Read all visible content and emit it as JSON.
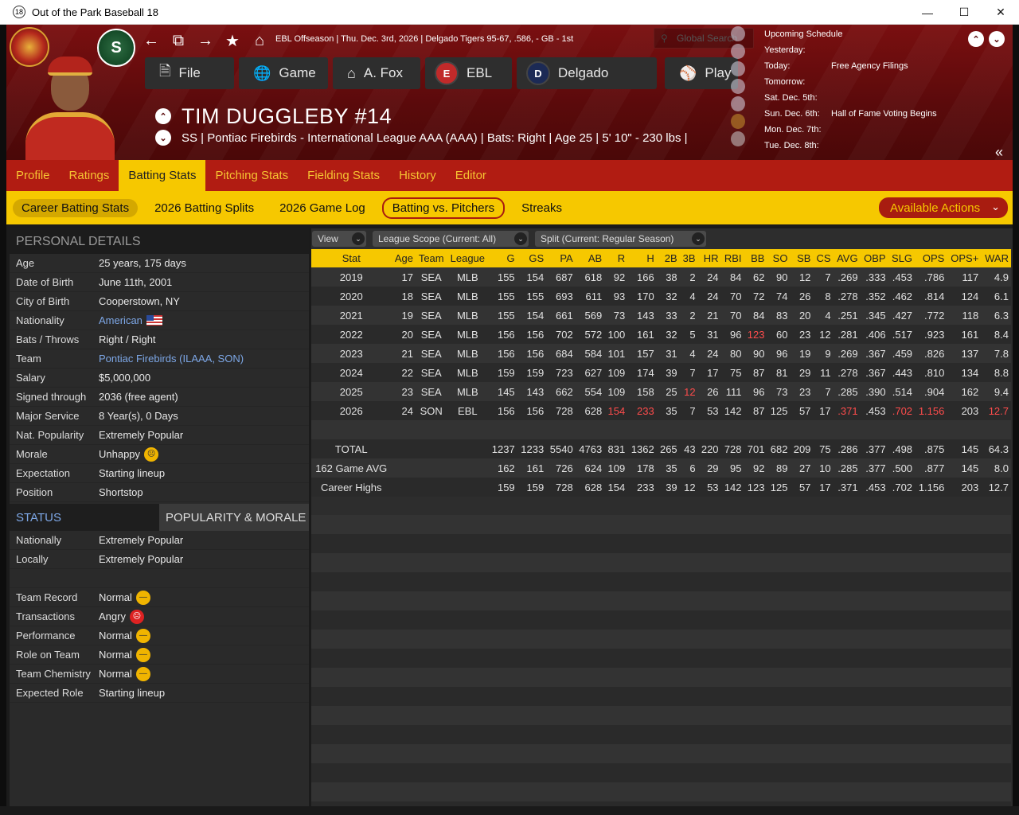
{
  "window": {
    "app_icon": "18",
    "title": "Out of the Park Baseball 18"
  },
  "breadcrumb": "EBL Offseason  |  Thu. Dec. 3rd, 2026  |  Delgado Tigers   95-67, .586, - GB - 1st",
  "search": {
    "placeholder": "Global Search"
  },
  "main_buttons": {
    "file": "File",
    "game": "Game",
    "manager": "A. Fox",
    "league": "EBL",
    "team": "Delgado",
    "play": "Play"
  },
  "player": {
    "name": "TIM DUGGLEBY  #14",
    "subtitle": "SS | Pontiac Firebirds - International League AAA (AAA)  |  Bats: Right  |  Age 25  |  5' 10\" - 230 lbs  |"
  },
  "schedule": {
    "title": "Upcoming Schedule",
    "rows": [
      {
        "day": "Yesterday:",
        "event": ""
      },
      {
        "day": "Today:",
        "event": "Free Agency Filings"
      },
      {
        "day": "Tomorrow:",
        "event": ""
      },
      {
        "day": "Sat. Dec. 5th:",
        "event": ""
      },
      {
        "day": "Sun. Dec. 6th:",
        "event": "Hall of Fame Voting Begins"
      },
      {
        "day": "Mon. Dec. 7th:",
        "event": ""
      },
      {
        "day": "Tue. Dec. 8th:",
        "event": ""
      }
    ]
  },
  "tabs": [
    "Profile",
    "Ratings",
    "Batting Stats",
    "Pitching Stats",
    "Fielding Stats",
    "History",
    "Editor"
  ],
  "subtabs": [
    "Career Batting Stats",
    "2026 Batting Splits",
    "2026 Game Log",
    "Batting vs. Pitchers",
    "Streaks"
  ],
  "available_actions": "Available Actions",
  "personal": {
    "heading": "PERSONAL DETAILS",
    "rows": [
      {
        "label": "Age",
        "value": "25 years, 175 days"
      },
      {
        "label": "Date of Birth",
        "value": "June 11th, 2001"
      },
      {
        "label": "City of Birth",
        "value": "Cooperstown, NY"
      },
      {
        "label": "Nationality",
        "value": "American"
      },
      {
        "label": "Bats / Throws",
        "value": "Right / Right"
      },
      {
        "label": "Team",
        "value": "Pontiac Firebirds (ILAAA, SON)"
      },
      {
        "label": "Salary",
        "value": "$5,000,000"
      },
      {
        "label": "Signed through",
        "value": "2036 (free agent)"
      },
      {
        "label": "Major Service",
        "value": "8 Year(s), 0 Days"
      },
      {
        "label": "Nat. Popularity",
        "value": "Extremely Popular"
      },
      {
        "label": "Morale",
        "value": "Unhappy"
      },
      {
        "label": "Expectation",
        "value": "Starting lineup"
      },
      {
        "label": "Position",
        "value": "Shortstop"
      }
    ]
  },
  "status": {
    "tab_status": "STATUS",
    "tab_popularity": "POPULARITY & MORALE",
    "rows": [
      {
        "label": "Nationally",
        "value": "Extremely Popular"
      },
      {
        "label": "Locally",
        "value": "Extremely Popular"
      },
      {
        "label": "",
        "value": ""
      },
      {
        "label": "Team Record",
        "value": "Normal"
      },
      {
        "label": "Transactions",
        "value": "Angry"
      },
      {
        "label": "Performance",
        "value": "Normal"
      },
      {
        "label": "Role on Team",
        "value": "Normal"
      },
      {
        "label": "Team Chemistry",
        "value": "Normal"
      },
      {
        "label": "Expected Role",
        "value": "Starting lineup"
      }
    ]
  },
  "filters": {
    "view": "View",
    "league_scope": "League Scope  (Current: All)",
    "split": "Split  (Current: Regular Season)"
  },
  "stats_table": {
    "columns": [
      "Stat",
      "Age",
      "Team",
      "League",
      "G",
      "GS",
      "PA",
      "AB",
      "R",
      "H",
      "2B",
      "3B",
      "HR",
      "RBI",
      "BB",
      "SO",
      "SB",
      "CS",
      "AVG",
      "OBP",
      "SLG",
      "OPS",
      "OPS+",
      "WAR"
    ],
    "rows": [
      [
        "2019",
        "17",
        "SEA",
        "MLB",
        "155",
        "154",
        "687",
        "618",
        "92",
        "166",
        "38",
        "2",
        "24",
        "84",
        "62",
        "90",
        "12",
        "7",
        ".269",
        ".333",
        ".453",
        ".786",
        "117",
        "4.9"
      ],
      [
        "2020",
        "18",
        "SEA",
        "MLB",
        "155",
        "155",
        "693",
        "611",
        "93",
        "170",
        "32",
        "4",
        "24",
        "70",
        "72",
        "74",
        "26",
        "8",
        ".278",
        ".352",
        ".462",
        ".814",
        "124",
        "6.1"
      ],
      [
        "2021",
        "19",
        "SEA",
        "MLB",
        "155",
        "154",
        "661",
        "569",
        "73",
        "143",
        "33",
        "2",
        "21",
        "70",
        "84",
        "83",
        "20",
        "4",
        ".251",
        ".345",
        ".427",
        ".772",
        "118",
        "6.3"
      ],
      [
        "2022",
        "20",
        "SEA",
        "MLB",
        "156",
        "156",
        "702",
        "572",
        "100",
        "161",
        "32",
        "5",
        "31",
        "96",
        "123",
        "60",
        "23",
        "12",
        ".281",
        ".406",
        ".517",
        ".923",
        "161",
        "8.4"
      ],
      [
        "2023",
        "21",
        "SEA",
        "MLB",
        "156",
        "156",
        "684",
        "584",
        "101",
        "157",
        "31",
        "4",
        "24",
        "80",
        "90",
        "96",
        "19",
        "9",
        ".269",
        ".367",
        ".459",
        ".826",
        "137",
        "7.8"
      ],
      [
        "2024",
        "22",
        "SEA",
        "MLB",
        "159",
        "159",
        "723",
        "627",
        "109",
        "174",
        "39",
        "7",
        "17",
        "75",
        "87",
        "81",
        "29",
        "11",
        ".278",
        ".367",
        ".443",
        ".810",
        "134",
        "8.8"
      ],
      [
        "2025",
        "23",
        "SEA",
        "MLB",
        "145",
        "143",
        "662",
        "554",
        "109",
        "158",
        "25",
        "12",
        "26",
        "111",
        "96",
        "73",
        "23",
        "7",
        ".285",
        ".390",
        ".514",
        ".904",
        "162",
        "9.4"
      ],
      [
        "2026",
        "24",
        "SON",
        "EBL",
        "156",
        "156",
        "728",
        "628",
        "154",
        "233",
        "35",
        "7",
        "53",
        "142",
        "87",
        "125",
        "57",
        "17",
        ".371",
        ".453",
        ".702",
        "1.156",
        "203",
        "12.7"
      ],
      [
        "",
        "",
        "",
        "",
        "",
        "",
        "",
        "",
        "",
        "",
        "",
        "",
        "",
        "",
        "",
        "",
        "",
        "",
        "",
        "",
        "",
        "",
        "",
        ""
      ],
      [
        "TOTAL",
        "",
        "",
        "",
        "1237",
        "1233",
        "5540",
        "4763",
        "831",
        "1362",
        "265",
        "43",
        "220",
        "728",
        "701",
        "682",
        "209",
        "75",
        ".286",
        ".377",
        ".498",
        ".875",
        "145",
        "64.3"
      ],
      [
        "162 Game AVG",
        "",
        "",
        "",
        "162",
        "161",
        "726",
        "624",
        "109",
        "178",
        "35",
        "6",
        "29",
        "95",
        "92",
        "89",
        "27",
        "10",
        ".285",
        ".377",
        ".500",
        ".877",
        "145",
        "8.0"
      ],
      [
        "Career Highs",
        "",
        "",
        "",
        "159",
        "159",
        "728",
        "628",
        "154",
        "233",
        "39",
        "12",
        "53",
        "142",
        "123",
        "125",
        "57",
        "17",
        ".371",
        ".453",
        ".702",
        "1.156",
        "203",
        "12.7"
      ]
    ],
    "highlight_color": "#ff4c4c",
    "highlights": [
      [
        3,
        14
      ],
      [
        6,
        11
      ],
      [
        7,
        8
      ],
      [
        7,
        9
      ],
      [
        7,
        18
      ],
      [
        7,
        20
      ],
      [
        7,
        21
      ],
      [
        7,
        23
      ]
    ]
  },
  "colors": {
    "header_red": "#7a0f10",
    "tab_red": "#b11c12",
    "accent_yellow": "#f6c800",
    "tab_text_yellow": "#f5c232",
    "link_blue": "#7da7e6"
  }
}
